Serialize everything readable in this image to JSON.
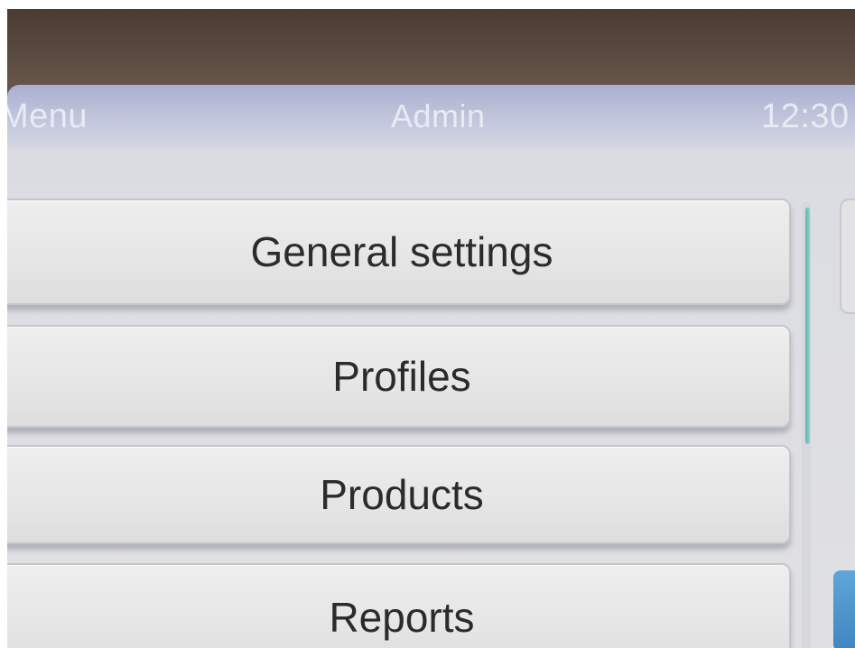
{
  "header": {
    "menu_label": "Menu",
    "title": "Admin",
    "time": "12:30"
  },
  "menu": {
    "items": [
      {
        "label": "General settings"
      },
      {
        "label": "Profiles"
      },
      {
        "label": "Products"
      },
      {
        "label": "Reports"
      }
    ]
  },
  "colors": {
    "header": "#b7bcd7",
    "button": "#e8e7e7",
    "scroll_thumb": "#6cc0bc",
    "side_button": "#4a93cc"
  }
}
